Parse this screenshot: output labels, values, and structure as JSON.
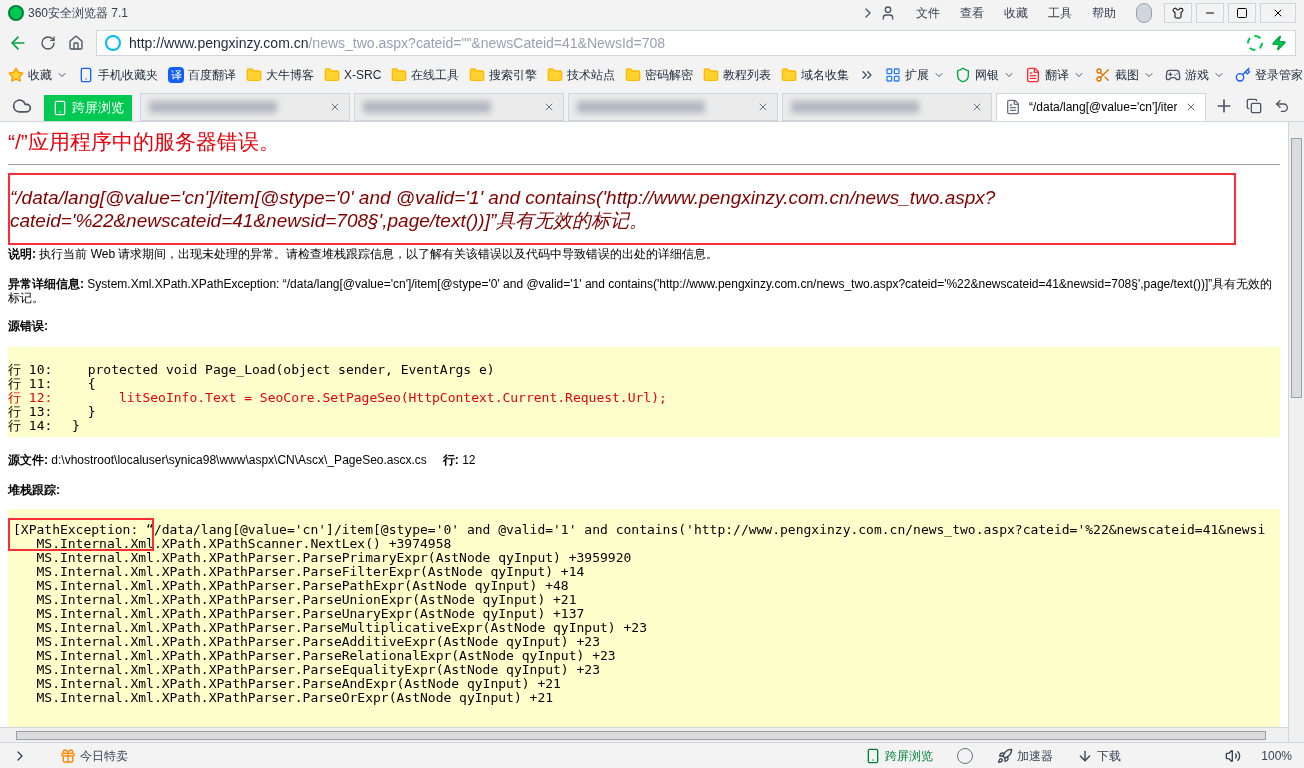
{
  "window": {
    "title": "360安全浏览器 7.1",
    "menu": [
      "文件",
      "查看",
      "收藏",
      "工具",
      "帮助"
    ]
  },
  "address_bar": {
    "url_host": "http://www.pengxinzy.com.cn",
    "url_path": "/news_two.aspx?cateid=\"\"&newsCateid=41&NewsId=708"
  },
  "bookmarks": [
    {
      "kind": "star",
      "label": "收藏",
      "dropdown": true
    },
    {
      "kind": "phone",
      "label": "手机收藏夹",
      "dropdown": false
    },
    {
      "kind": "translate",
      "badge": "译",
      "label": "百度翻译",
      "dropdown": false
    },
    {
      "kind": "folder",
      "label": "大牛博客",
      "dropdown": false
    },
    {
      "kind": "folder",
      "label": "X-SRC",
      "dropdown": false
    },
    {
      "kind": "folder",
      "label": "在线工具",
      "dropdown": false
    },
    {
      "kind": "folder",
      "label": "搜索引擎",
      "dropdown": false
    },
    {
      "kind": "folder",
      "label": "技术站点",
      "dropdown": false
    },
    {
      "kind": "folder",
      "label": "密码解密",
      "dropdown": false
    },
    {
      "kind": "folder",
      "label": "教程列表",
      "dropdown": false
    },
    {
      "kind": "folder",
      "label": "域名收集",
      "dropdown": false
    }
  ],
  "toolbar": [
    {
      "kind": "grid",
      "label": "扩展",
      "dropdown": true
    },
    {
      "kind": "shield",
      "label": "网银",
      "dropdown": true
    },
    {
      "kind": "translate2",
      "label": "翻译",
      "dropdown": true
    },
    {
      "kind": "scissors",
      "label": "截图",
      "dropdown": true
    },
    {
      "kind": "gamepad",
      "label": "游戏",
      "dropdown": true
    },
    {
      "kind": "key",
      "label": "登录管家",
      "dropdown": false
    }
  ],
  "tabs": [
    {
      "kind": "blurred",
      "selected": false
    },
    {
      "kind": "blurred",
      "selected": false
    },
    {
      "kind": "blurred",
      "selected": false
    },
    {
      "kind": "blurred",
      "selected": false
    },
    {
      "kind": "page",
      "label": "“/data/lang[@value='cn']/iter",
      "selected": true
    }
  ],
  "cross_screen_button": "跨屏浏览",
  "page": {
    "heading": "“/”应用程序中的服务器错误。",
    "message": "“/data/lang[@value='cn']/item[@stype='0' and @valid='1' and contains('http://www.pengxinzy.com.cn/news_two.aspx?cateid='%22&newscateid=41&newsid=708§',page/text())]”具有无效的标记。",
    "description_label": "说明:",
    "description": "执行当前 Web 请求期间，出现未处理的异常。请检查堆栈跟踪信息，以了解有关该错误以及代码中导致错误的出处的详细信息。",
    "exception_label": "异常详细信息:",
    "exception": "System.Xml.XPath.XPathException: “/data/lang[@value='cn']/item[@stype='0' and @valid='1' and contains('http://www.pengxinzy.com.cn/news_two.aspx?cateid='%22&newscateid=41&newsid=708§',page/text())]”具有无效的标记。",
    "source_error_label": "源错误:",
    "code_lines": [
      {
        "line": "行 10:",
        "code": "  protected void Page_Load(object sender, EventArgs e)",
        "highlighted": false
      },
      {
        "line": "行 11:",
        "code": "  {",
        "highlighted": false
      },
      {
        "line": "行 12:",
        "code": "      litSeoInfo.Text = SeoCore.SetPageSeo(HttpContext.Current.Request.Url);",
        "highlighted": true
      },
      {
        "line": "行 13:",
        "code": "  }",
        "highlighted": false
      },
      {
        "line": "行 14:",
        "code": "}",
        "highlighted": false
      }
    ],
    "source_file_label": "源文件:",
    "source_file": "d:\\vhostroot\\localuser\\synica98\\www\\aspx\\CN\\Ascx\\_PageSeo.ascx.cs",
    "line_label": "行:",
    "line": "12",
    "stack_label": "堆栈跟踪:",
    "stack_lines": [
      "[XPathException: “/data/lang[@value='cn']/item[@stype='0' and @valid='1' and contains('http://www.pengxinzy.com.cn/news_two.aspx?cateid='%22&newscateid=41&newsi",
      "   MS.Internal.Xml.XPath.XPathScanner.NextLex() +3974958",
      "   MS.Internal.Xml.XPath.XPathParser.ParsePrimaryExpr(AstNode qyInput) +3959920",
      "   MS.Internal.Xml.XPath.XPathParser.ParseFilterExpr(AstNode qyInput) +14",
      "   MS.Internal.Xml.XPath.XPathParser.ParsePathExpr(AstNode qyInput) +48",
      "   MS.Internal.Xml.XPath.XPathParser.ParseUnionExpr(AstNode qyInput) +21",
      "   MS.Internal.Xml.XPath.XPathParser.ParseUnaryExpr(AstNode qyInput) +137",
      "   MS.Internal.Xml.XPath.XPathParser.ParseMultiplicativeExpr(AstNode qyInput) +23",
      "   MS.Internal.Xml.XPath.XPathParser.ParseAdditiveExpr(AstNode qyInput) +23",
      "   MS.Internal.Xml.XPath.XPathParser.ParseRelationalExpr(AstNode qyInput) +23",
      "   MS.Internal.Xml.XPath.XPathParser.ParseEqualityExpr(AstNode qyInput) +23",
      "   MS.Internal.Xml.XPath.XPathParser.ParseAndExpr(AstNode qyInput) +21",
      "   MS.Internal.Xml.XPath.XPathParser.ParseOrExpr(AstNode qyInput) +21"
    ]
  },
  "status_bar": {
    "deals": "今日特卖",
    "cross_screen": "跨屏浏览",
    "accelerator": "加速器",
    "download": "下载",
    "zoom": "100%"
  }
}
